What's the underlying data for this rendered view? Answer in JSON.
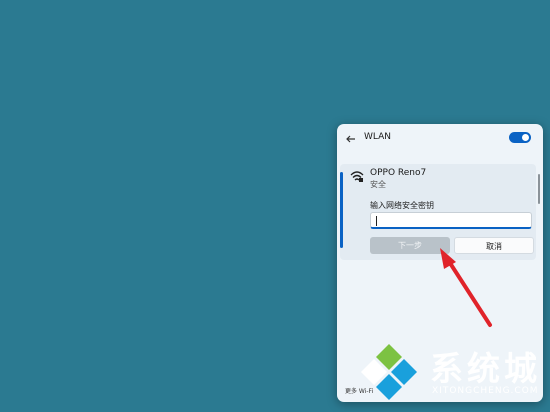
{
  "wlan_panel": {
    "title": "WLAN",
    "wifi_enabled": true,
    "network": {
      "name": "OPPO Reno7",
      "status": "安全",
      "password_label": "输入网络安全密钥",
      "password_value": "",
      "next_button": "下一步",
      "cancel_button": "取消"
    },
    "footer_link": "更多 Wi-Fi"
  },
  "watermark": {
    "brand": "系统城",
    "domain": "XITONGCHENG.COM"
  },
  "colors": {
    "desktop": "#2b7a91",
    "accent": "#0a62c4",
    "annotation_arrow": "#e0232a"
  },
  "icons": [
    "back-arrow-icon",
    "wifi-secure-icon",
    "toggle-switch",
    "red-pointer-arrow",
    "logo-icon"
  ]
}
